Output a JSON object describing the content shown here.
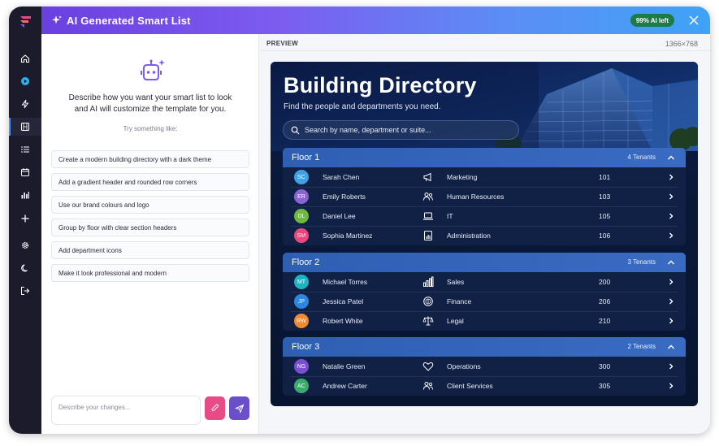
{
  "header": {
    "title": "AI Generated Smart List",
    "ai_badge": "99% AI left"
  },
  "colors": {
    "header_gradient": [
      "#6b3fe0",
      "#3fa3f7"
    ],
    "rail": "#1b1b2b",
    "attach_button": "#e94b86",
    "send_button": "#6a4fc9",
    "card_background": "#0b1f4a",
    "floor_header": "#2f5fb3"
  },
  "sidebar": {
    "items": [
      {
        "icon": "home-icon"
      },
      {
        "icon": "play-icon"
      },
      {
        "icon": "lightning-icon"
      },
      {
        "icon": "film-icon",
        "active": true
      },
      {
        "icon": "list-icon"
      },
      {
        "icon": "calendar-icon"
      },
      {
        "icon": "bar-chart-icon"
      },
      {
        "icon": "plus-icon"
      },
      {
        "icon": "gear-icon"
      },
      {
        "icon": "moon-icon"
      },
      {
        "icon": "logout-icon"
      }
    ]
  },
  "prompt": {
    "intro": "Describe how you want your smart list to look and AI will customize the template for you.",
    "try_label": "Try something like:",
    "suggestions": [
      "Create a modern building directory with a dark theme",
      "Add a gradient header and rounded row corners",
      "Use our brand colours and logo",
      "Group by floor with clear section headers",
      "Add department icons",
      "Make it look professional and modern"
    ],
    "input_placeholder": "Describe your changes..."
  },
  "preview": {
    "label": "PREVIEW",
    "resolution": "1366×768"
  },
  "directory": {
    "title": "Building Directory",
    "subtitle": "Find the people and departments you need.",
    "search_placeholder": "Search by name, department or suite...",
    "floors": [
      {
        "name": "Floor 1",
        "count": "4 Tenants",
        "tenants": [
          {
            "initials": "SC",
            "name": "Sarah Chen",
            "dept": "Marketing",
            "dept_icon": "megaphone-icon",
            "suite": "101",
            "color": "#3fa0e6"
          },
          {
            "initials": "ER",
            "name": "Emily Roberts",
            "dept": "Human Resources",
            "dept_icon": "people-icon",
            "suite": "103",
            "color": "#8a63d6"
          },
          {
            "initials": "DL",
            "name": "Daniel Lee",
            "dept": "IT",
            "dept_icon": "laptop-icon",
            "suite": "105",
            "color": "#6db83f"
          },
          {
            "initials": "SM",
            "name": "Sophia Martinez",
            "dept": "Administration",
            "dept_icon": "document-chart-icon",
            "suite": "106",
            "color": "#e8487e"
          }
        ]
      },
      {
        "name": "Floor 2",
        "count": "3 Tenants",
        "tenants": [
          {
            "initials": "MT",
            "name": "Michael Torres",
            "dept": "Sales",
            "dept_icon": "bar-chart-icon",
            "suite": "200",
            "color": "#1fb3c2"
          },
          {
            "initials": "JP",
            "name": "Jessica Patel",
            "dept": "Finance",
            "dept_icon": "coin-icon",
            "suite": "206",
            "color": "#2f86e0"
          },
          {
            "initials": "RW",
            "name": "Robert White",
            "dept": "Legal",
            "dept_icon": "scales-icon",
            "suite": "210",
            "color": "#f08a2e"
          }
        ]
      },
      {
        "name": "Floor 3",
        "count": "2 Tenants",
        "tenants": [
          {
            "initials": "NG",
            "name": "Natalie Green",
            "dept": "Operations",
            "dept_icon": "heart-icon",
            "suite": "300",
            "color": "#7a4fd6"
          },
          {
            "initials": "AC",
            "name": "Andrew Carter",
            "dept": "Client Services",
            "dept_icon": "people-icon",
            "suite": "305",
            "color": "#3aab6b"
          }
        ]
      }
    ]
  }
}
